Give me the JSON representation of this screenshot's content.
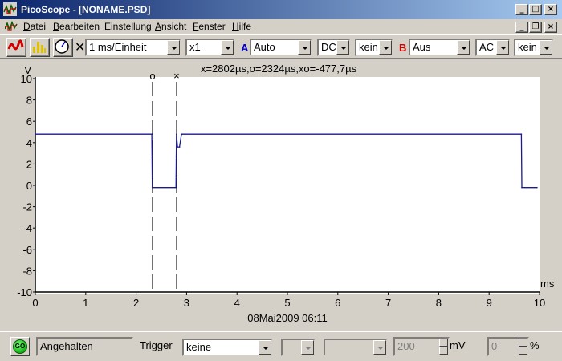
{
  "window": {
    "title": "PicoScope - [NONAME.PSD]",
    "controls": {
      "minimize": "_",
      "maximize": "□",
      "close": "×"
    }
  },
  "menubar": {
    "items": [
      "Datei",
      "Bearbeiten",
      "Einstellung",
      "Ansicht",
      "Fenster",
      "Hilfe"
    ],
    "mnemonics": [
      "D",
      "B",
      "",
      "A",
      "F",
      "H"
    ],
    "mdi_controls": {
      "minimize": "_",
      "restore": "❐",
      "close": "×"
    }
  },
  "toolbar": {
    "cross_mark": "✕",
    "timebase": "1 ms/Einheit",
    "multiplier": "x1",
    "channel_a": {
      "letter": "A",
      "color": "#0000c0",
      "range": "Auto",
      "coupling": "DC",
      "filter": "kein"
    },
    "channel_b": {
      "letter": "B",
      "color": "#d00000",
      "range": "Aus",
      "coupling": "AC",
      "filter": "kein"
    }
  },
  "chart_data": {
    "type": "line",
    "ylabel": "V",
    "xlabel": "ms",
    "xlim": [
      0,
      10
    ],
    "ylim": [
      -10,
      10
    ],
    "x_ticks": [
      0,
      1,
      2,
      3,
      4,
      5,
      6,
      7,
      8,
      9,
      10
    ],
    "y_ticks": [
      10,
      8,
      6,
      4,
      2,
      0,
      -2,
      -4,
      -6,
      -8,
      -10
    ],
    "x_tick_labels": [
      "0",
      "1",
      "2",
      "3",
      "4",
      "5",
      "6",
      "7",
      "8",
      "9",
      "10"
    ],
    "y_tick_labels": [
      "10",
      "8",
      "6",
      "4",
      "2",
      "0",
      "-2",
      "-4",
      "-6",
      "-8",
      "-10"
    ],
    "cursor_readout": "x=2802µs,o=2324µs,xo=-477,7µs",
    "cursors": [
      {
        "label": "o",
        "x": 2.324
      },
      {
        "label": "×",
        "x": 2.802
      }
    ],
    "timestamp": "08Mai2009  06:11",
    "series": [
      {
        "color": "#1a1a8c",
        "x": [
          0,
          2.31,
          2.32,
          2.79,
          2.8,
          2.82,
          2.86,
          2.9,
          2.91,
          9.64,
          9.65,
          9.95
        ],
        "y": [
          4.8,
          4.8,
          -0.2,
          -0.2,
          4.8,
          3.6,
          3.6,
          4.8,
          4.8,
          4.8,
          -0.2,
          -0.2
        ]
      }
    ]
  },
  "statusbar": {
    "go_label": "GO",
    "status": "Angehalten",
    "trigger_label": "Trigger",
    "trigger_mode": "keine",
    "level_value": "200",
    "level_unit": "mV",
    "delay_value": "0",
    "delay_unit": "%"
  }
}
